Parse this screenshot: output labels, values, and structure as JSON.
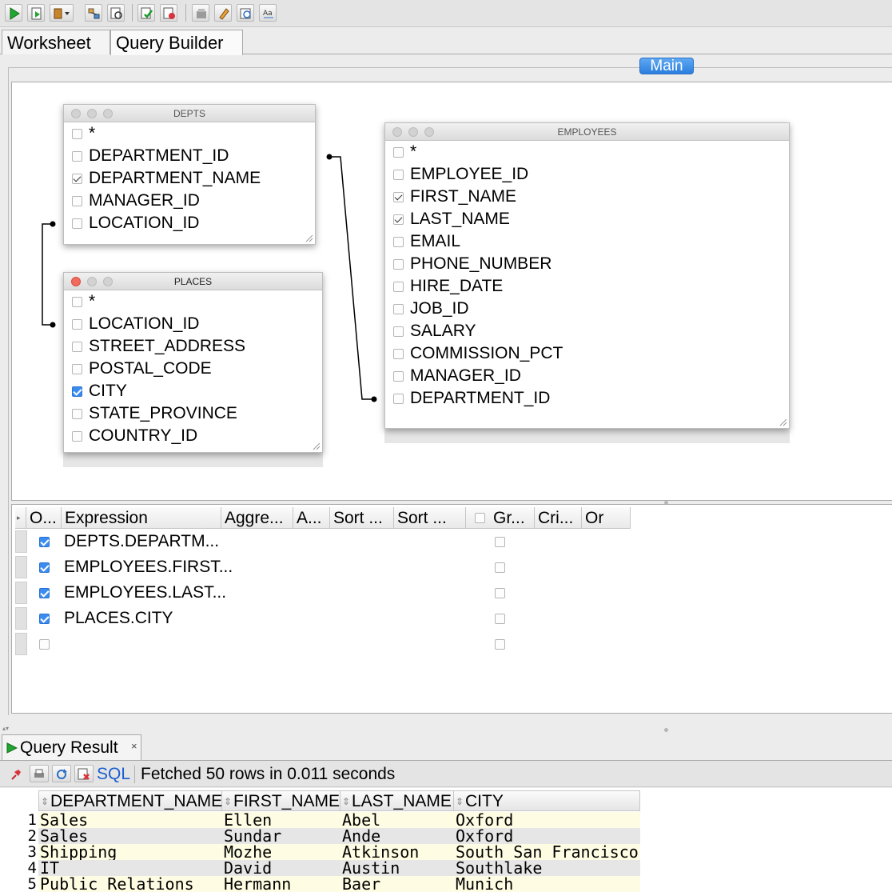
{
  "toolbar": {
    "buttons": [
      "run-statement-icon",
      "run-script-icon",
      "autotrace-icon",
      "explain-plan-icon",
      "sql-tuning-icon",
      "commit-icon",
      "rollback-icon",
      "unshared-sql-icon",
      "clear-icon",
      "history-icon",
      "format-case-icon"
    ]
  },
  "tabs": [
    {
      "label": "Worksheet"
    },
    {
      "label": "Query Builder"
    }
  ],
  "main_button": "Main",
  "tables": {
    "depts": {
      "title": "DEPTS",
      "columns": [
        {
          "name": "*",
          "checked": false
        },
        {
          "name": "DEPARTMENT_ID",
          "checked": false
        },
        {
          "name": "DEPARTMENT_NAME",
          "checked": true
        },
        {
          "name": "MANAGER_ID",
          "checked": false
        },
        {
          "name": "LOCATION_ID",
          "checked": false
        }
      ]
    },
    "places": {
      "title": "PLACES",
      "columns": [
        {
          "name": "*",
          "checked": false
        },
        {
          "name": "LOCATION_ID",
          "checked": false
        },
        {
          "name": "STREET_ADDRESS",
          "checked": false
        },
        {
          "name": "POSTAL_CODE",
          "checked": false
        },
        {
          "name": "CITY",
          "checked": true
        },
        {
          "name": "STATE_PROVINCE",
          "checked": false
        },
        {
          "name": "COUNTRY_ID",
          "checked": false
        }
      ]
    },
    "employees": {
      "title": "EMPLOYEES",
      "columns": [
        {
          "name": "*",
          "checked": false
        },
        {
          "name": "EMPLOYEE_ID",
          "checked": false
        },
        {
          "name": "FIRST_NAME",
          "checked": true
        },
        {
          "name": "LAST_NAME",
          "checked": true
        },
        {
          "name": "EMAIL",
          "checked": false
        },
        {
          "name": "PHONE_NUMBER",
          "checked": false
        },
        {
          "name": "HIRE_DATE",
          "checked": false
        },
        {
          "name": "JOB_ID",
          "checked": false
        },
        {
          "name": "SALARY",
          "checked": false
        },
        {
          "name": "COMMISSION_PCT",
          "checked": false
        },
        {
          "name": "MANAGER_ID",
          "checked": false
        },
        {
          "name": "DEPARTMENT_ID",
          "checked": false
        }
      ]
    }
  },
  "grid": {
    "headers": [
      "O...",
      "Expression",
      "Aggre...",
      "A...",
      "Sort ...",
      "Sort ...",
      "Gr...",
      "Cri...",
      "Or"
    ],
    "rows": [
      {
        "output": true,
        "expression": "DEPTS.DEPARTM..."
      },
      {
        "output": true,
        "expression": "EMPLOYEES.FIRST..."
      },
      {
        "output": true,
        "expression": "EMPLOYEES.LAST..."
      },
      {
        "output": true,
        "expression": "PLACES.CITY"
      },
      {
        "output": false,
        "expression": ""
      }
    ]
  },
  "result": {
    "tab_label": "Query Result",
    "close_glyph": "×",
    "sql_label": "SQL",
    "status": "Fetched 50 rows in 0.011 seconds",
    "columns": [
      "DEPARTMENT_NAME",
      "FIRST_NAME",
      "LAST_NAME",
      "CITY"
    ],
    "rows": [
      {
        "num": "1",
        "cells": [
          "Sales",
          "Ellen",
          "Abel",
          "Oxford"
        ]
      },
      {
        "num": "2",
        "cells": [
          "Sales",
          "Sundar",
          "Ande",
          "Oxford"
        ]
      },
      {
        "num": "3",
        "cells": [
          "Shipping",
          "Mozhe",
          "Atkinson",
          "South San Francisco"
        ]
      },
      {
        "num": "4",
        "cells": [
          "IT",
          "David",
          "Austin",
          "Southlake"
        ]
      },
      {
        "num": "5",
        "cells": [
          "Public Relations",
          "Hermann",
          "Baer",
          "Munich"
        ]
      }
    ],
    "row_colors": [
      "#fefde3",
      "#e6e6e6"
    ]
  }
}
